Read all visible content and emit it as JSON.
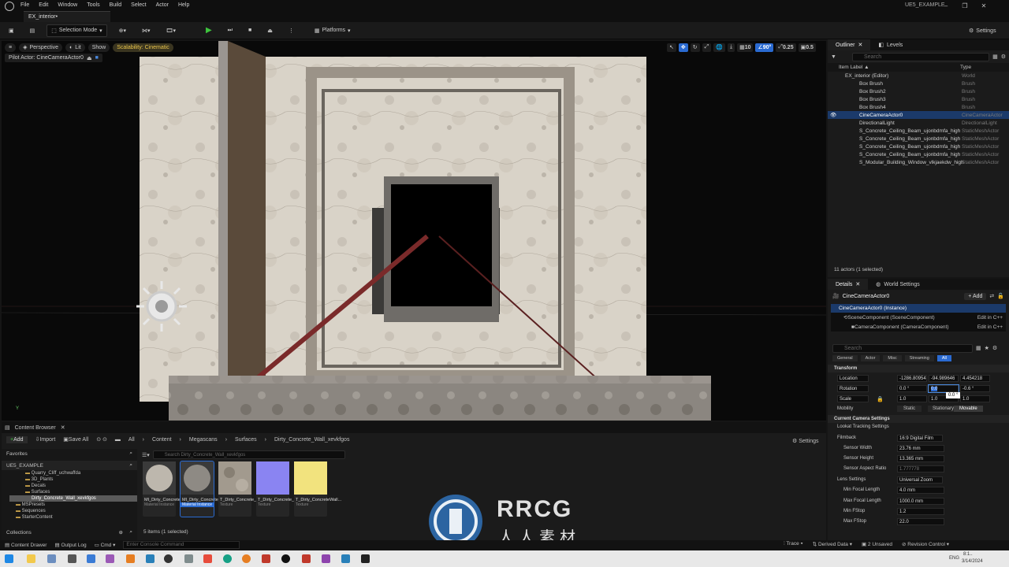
{
  "window": {
    "menu": [
      "File",
      "Edit",
      "Window",
      "Tools",
      "Build",
      "Select",
      "Actor",
      "Help"
    ],
    "tab": "EX_interior•",
    "project": "UE5_EXAMPLE"
  },
  "toolbar": {
    "selection_mode": "Selection Mode",
    "platforms": "Platforms",
    "settings": "Settings"
  },
  "viewport": {
    "perspective": "Perspective",
    "lit": "Lit",
    "show": "Show",
    "scalability": "Scalability: Cinematic",
    "pilot": "Pilot Actor: CineCameraActor0",
    "grid": "10",
    "angle": "90°",
    "scale": "0.25",
    "speed": "0.5"
  },
  "outliner": {
    "tab": "Outliner",
    "tab2": "Levels",
    "search_placeholder": "Search",
    "col_label": "Item Label ▲",
    "col_type": "Type",
    "items": [
      {
        "label": "EX_interior (Editor)",
        "type": "World"
      },
      {
        "label": "Box Brush",
        "type": "Brush"
      },
      {
        "label": "Box Brush2",
        "type": "Brush"
      },
      {
        "label": "Box Brush3",
        "type": "Brush"
      },
      {
        "label": "Box Brush4",
        "type": "Brush"
      },
      {
        "label": "CineCameraActor0",
        "type": "CineCameraActor"
      },
      {
        "label": "DirectionalLight",
        "type": "DirectionalLight"
      },
      {
        "label": "S_Concrete_Ceiling_Beam_ujonbdmfa_high",
        "type": "StaticMeshActor"
      },
      {
        "label": "S_Concrete_Ceiling_Beam_ujonbdmfa_high",
        "type": "StaticMeshActor"
      },
      {
        "label": "S_Concrete_Ceiling_Beam_ujonbdmfa_high",
        "type": "StaticMeshActor"
      },
      {
        "label": "S_Concrete_Ceiling_Beam_ujonbdmfa_high",
        "type": "StaticMeshActor"
      },
      {
        "label": "S_Modular_Building_Window_vlkjaekdw_high",
        "type": "StaticMeshActor"
      }
    ],
    "count": "11 actors (1 selected)"
  },
  "details": {
    "tab": "Details",
    "tab2": "World Settings",
    "actor": "CineCameraActor0",
    "add": "+ Add",
    "instance": "CineCameraActor0 (Instance)",
    "comp1": "SceneComponent (SceneComponent)",
    "comp2": "CameraComponent (CameraComponent)",
    "edit_cpp": "Edit in C++",
    "search_placeholder": "Search",
    "filters": [
      "General",
      "Actor",
      "Misc",
      "Streaming",
      "All"
    ],
    "transform": "Transform",
    "location": "Location",
    "rotation": "Rotation",
    "scale": "Scale",
    "mobility": "Mobility",
    "loc": [
      "-1286.80954",
      "-94.989646",
      "4.454218"
    ],
    "rot": [
      "0.0 °",
      "0.0",
      "-0.6 °"
    ],
    "scl": [
      "1.0",
      "1.0",
      "1.0"
    ],
    "tooltip": "0.0 °",
    "mob": [
      "Static",
      "Stationary",
      "Movable"
    ],
    "camera_settings": "Current Camera Settings",
    "lookat": "Lookat Tracking Settings",
    "filmback": "Filmback",
    "filmback_val": "16:9 Digital Film",
    "sensor_width": "Sensor Width",
    "sensor_width_val": "23.76 mm",
    "sensor_height": "Sensor Height",
    "sensor_height_val": "13.365 mm",
    "aspect": "Sensor Aspect Ratio",
    "aspect_val": "1.777778",
    "lens": "Lens Settings",
    "lens_val": "Universal Zoom",
    "minfl": "Min Focal Length",
    "minfl_val": "4.0 mm",
    "maxfl": "Max Focal Length",
    "maxfl_val": "1000.0 mm",
    "minf": "Min FStop",
    "minf_val": "1.2",
    "maxf": "Max FStop",
    "maxf_val": "22.0"
  },
  "content": {
    "tab": "Content Browser",
    "add": "Add",
    "import": "Import",
    "save": "Save All",
    "crumbs": [
      "All",
      "Content",
      "Megascans",
      "Surfaces",
      "Dirty_Concrete_Wall_xevkfgos"
    ],
    "settings": "Settings",
    "favorites": "Favorites",
    "root": "UE5_EXAMPLE",
    "search_placeholder": "Search Dirty_Concrete_Wall_xevkfgos",
    "tree": [
      "Quarry_Cliff_uchwaffda",
      "3D_Plants",
      "Decals",
      "Surfaces",
      "Dirty_Concrete_Wall_xevkfgos",
      "MSPresets",
      "Sequences",
      "StarterContent"
    ],
    "collections": "Collections",
    "count": "5 items (1 selected)",
    "assets": [
      {
        "name": "MI_Dirty_Concrete_W...",
        "type": "Material Instance"
      },
      {
        "name": "MI_Dirty_Concrete_Wa...",
        "type": "Material Instance"
      },
      {
        "name": "T_Dirty_Concrete_Wa...",
        "type": "Texture"
      },
      {
        "name": "T_Dirty_Concrete_Wa...",
        "type": "Texture"
      },
      {
        "name": "T_Dirty_ConcreteWall...",
        "type": "Texture"
      }
    ]
  },
  "status": {
    "drawer": "Content Drawer",
    "output": "Output Log",
    "cmd": "Cmd",
    "console": "Enter Console Command",
    "trace": "Trace",
    "derived": "Derived Data",
    "unsaved": "2 Unsaved",
    "revision": "Revision Control"
  },
  "taskbar": {
    "lang": "ENG",
    "time": "8:1..",
    "date": "3/14/2024"
  },
  "watermark": {
    "logo": "RRCG",
    "sub": "人人素材"
  }
}
